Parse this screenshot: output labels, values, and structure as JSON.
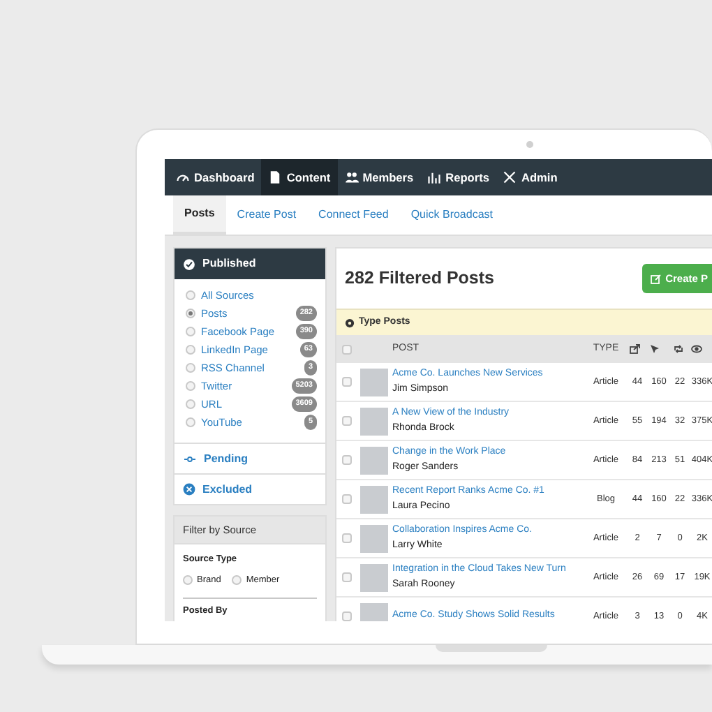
{
  "nav": [
    {
      "label": "Dashboard",
      "selected": false
    },
    {
      "label": "Content",
      "selected": true
    },
    {
      "label": "Members",
      "selected": false
    },
    {
      "label": "Reports",
      "selected": false
    },
    {
      "label": "Admin",
      "selected": false
    }
  ],
  "subnav": [
    {
      "label": "Posts",
      "selected": true
    },
    {
      "label": "Create Post",
      "selected": false
    },
    {
      "label": "Connect Feed",
      "selected": false
    },
    {
      "label": "Quick Broadcast",
      "selected": false
    }
  ],
  "sidebar": {
    "published": {
      "title": "Published",
      "sources": [
        {
          "label": "All Sources",
          "selected": false
        },
        {
          "label": "Posts",
          "selected": true,
          "count": "282"
        },
        {
          "label": "Facebook Page",
          "selected": false,
          "count": "390"
        },
        {
          "label": "LinkedIn Page",
          "selected": false,
          "count": "63"
        },
        {
          "label": "RSS Channel",
          "selected": false,
          "count": "3"
        },
        {
          "label": "Twitter",
          "selected": false,
          "count": "5203"
        },
        {
          "label": "URL",
          "selected": false,
          "count": "3609"
        },
        {
          "label": "YouTube",
          "selected": false,
          "count": "5"
        }
      ]
    },
    "pending": "Pending",
    "excluded": "Excluded",
    "filter": {
      "title": "Filter by Source",
      "source_type_label": "Source Type",
      "options": [
        {
          "label": "Brand",
          "selected": false
        },
        {
          "label": "Member",
          "selected": false
        }
      ],
      "posted_by_label": "Posted By"
    }
  },
  "main": {
    "title": "282 Filtered Posts",
    "create_button": "Create P",
    "type_posts": "Type Posts",
    "columns": {
      "post": "POST",
      "type": "TYPE"
    },
    "select_all_checked": false,
    "rows": [
      {
        "title": "Acme Co. Launches New Services",
        "author": "Jim Simpson",
        "type": "Article",
        "shares": "44",
        "clicks": "160",
        "retweets": "22",
        "views": "336K",
        "checked": false
      },
      {
        "title": "A New View of the Industry",
        "author": "Rhonda Brock",
        "type": "Article",
        "shares": "55",
        "clicks": "194",
        "retweets": "32",
        "views": "375K",
        "checked": false
      },
      {
        "title": "Change in the Work Place",
        "author": "Roger Sanders",
        "type": "Article",
        "shares": "84",
        "clicks": "213",
        "retweets": "51",
        "views": "404K",
        "checked": false
      },
      {
        "title": "Recent Report Ranks Acme Co. #1",
        "author": "Laura Pecino",
        "type": "Blog",
        "shares": "44",
        "clicks": "160",
        "retweets": "22",
        "views": "336K",
        "checked": false
      },
      {
        "title": "Collaboration Inspires Acme Co.",
        "author": "Larry White",
        "type": "Article",
        "shares": "2",
        "clicks": "7",
        "retweets": "0",
        "views": "2K",
        "checked": false
      },
      {
        "title": "Integration in the Cloud Takes New Turn",
        "author": "Sarah Rooney",
        "type": "Article",
        "shares": "26",
        "clicks": "69",
        "retweets": "17",
        "views": "19K",
        "checked": false
      },
      {
        "title": "Acme Co. Study Shows Solid Results",
        "type": "Article",
        "shares": "3",
        "clicks": "13",
        "retweets": "0",
        "views": "4K",
        "checked": false
      }
    ]
  }
}
